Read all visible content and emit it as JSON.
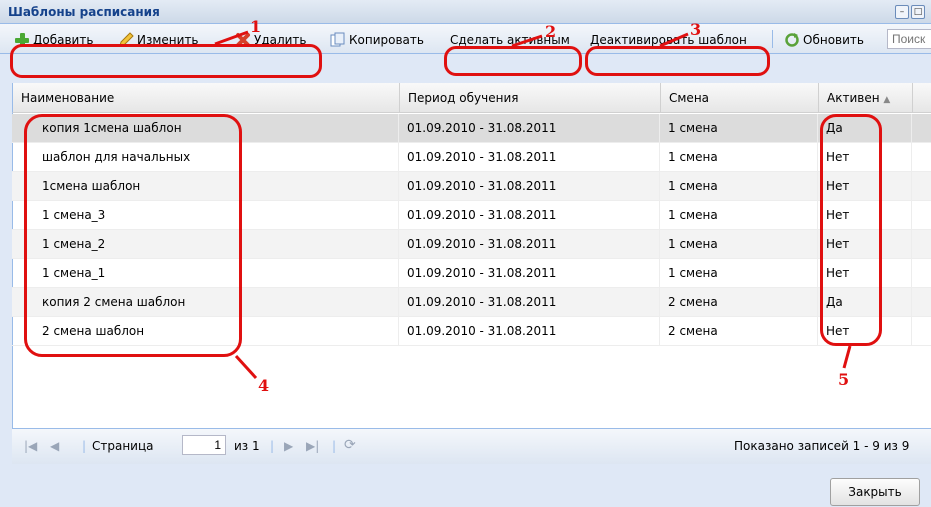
{
  "window": {
    "title": "Шаблоны расписания"
  },
  "toolbar": {
    "add": "Добавить",
    "edit": "Изменить",
    "delete": "Удалить",
    "copy": "Копировать",
    "activate": "Сделать активным",
    "deactivate": "Деактивировать шаблон",
    "refresh": "Обновить",
    "search_placeholder": "Поиск"
  },
  "grid": {
    "columns": [
      "Наименование",
      "Период обучения",
      "Смена",
      "Активен"
    ],
    "rows": [
      [
        "копия 1смена шаблон",
        "01.09.2010 - 31.08.2011",
        "1 смена",
        "Да"
      ],
      [
        "шаблон для начальных",
        "01.09.2010 - 31.08.2011",
        "1 смена",
        "Нет"
      ],
      [
        "1смена шаблон",
        "01.09.2010 - 31.08.2011",
        "1 смена",
        "Нет"
      ],
      [
        "1 смена_3",
        "01.09.2010 - 31.08.2011",
        "1 смена",
        "Нет"
      ],
      [
        "1 смена_2",
        "01.09.2010 - 31.08.2011",
        "1 смена",
        "Нет"
      ],
      [
        "1 смена_1",
        "01.09.2010 - 31.08.2011",
        "1 смена",
        "Нет"
      ],
      [
        "копия 2 смена шаблон",
        "01.09.2010 - 31.08.2011",
        "2 смена",
        "Да"
      ],
      [
        "2 смена шаблон",
        "01.09.2010 - 31.08.2011",
        "2 смена",
        "Нет"
      ]
    ]
  },
  "pager": {
    "page_label": "Страница",
    "page_value": "1",
    "of_label": "из 1",
    "summary": "Показано записей 1 - 9 из 9"
  },
  "footer": {
    "close": "Закрыть"
  },
  "annotations": [
    "1",
    "2",
    "3",
    "4",
    "5"
  ],
  "colors": {
    "annotation": "#e01010",
    "header": "#15428b"
  }
}
